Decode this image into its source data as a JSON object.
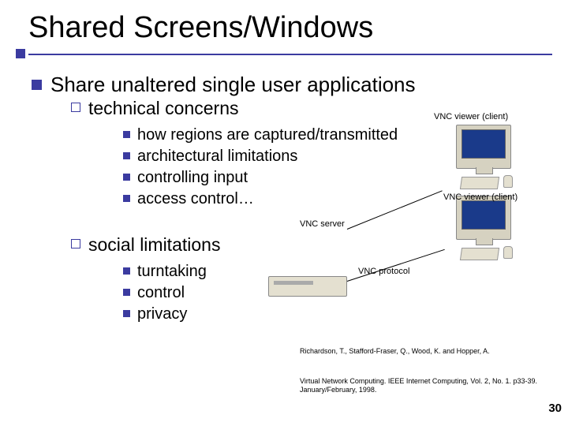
{
  "title": "Shared Screens/Windows",
  "main_bullet": "Share unaltered single user applications",
  "sub1": {
    "heading": "technical concerns",
    "items": [
      "how regions are captured/transmitted",
      "architectural limitations",
      "controlling input",
      "access control…"
    ]
  },
  "sub2": {
    "heading": "social limitations",
    "items": [
      "turntaking",
      "control",
      "privacy"
    ]
  },
  "diagram": {
    "label_client_top": "VNC viewer (client)",
    "label_client_right": "VNC viewer (client)",
    "label_server": "VNC server",
    "label_protocol": "VNC protocol"
  },
  "citation": {
    "line1": "Richardson, T., Stafford-Fraser, Q., Wood, K. and Hopper, A.",
    "line2": "Virtual Network Computing. IEEE Internet Computing, Vol. 2, No. 1. p33-39. January/February, 1998."
  },
  "page_number": "30"
}
